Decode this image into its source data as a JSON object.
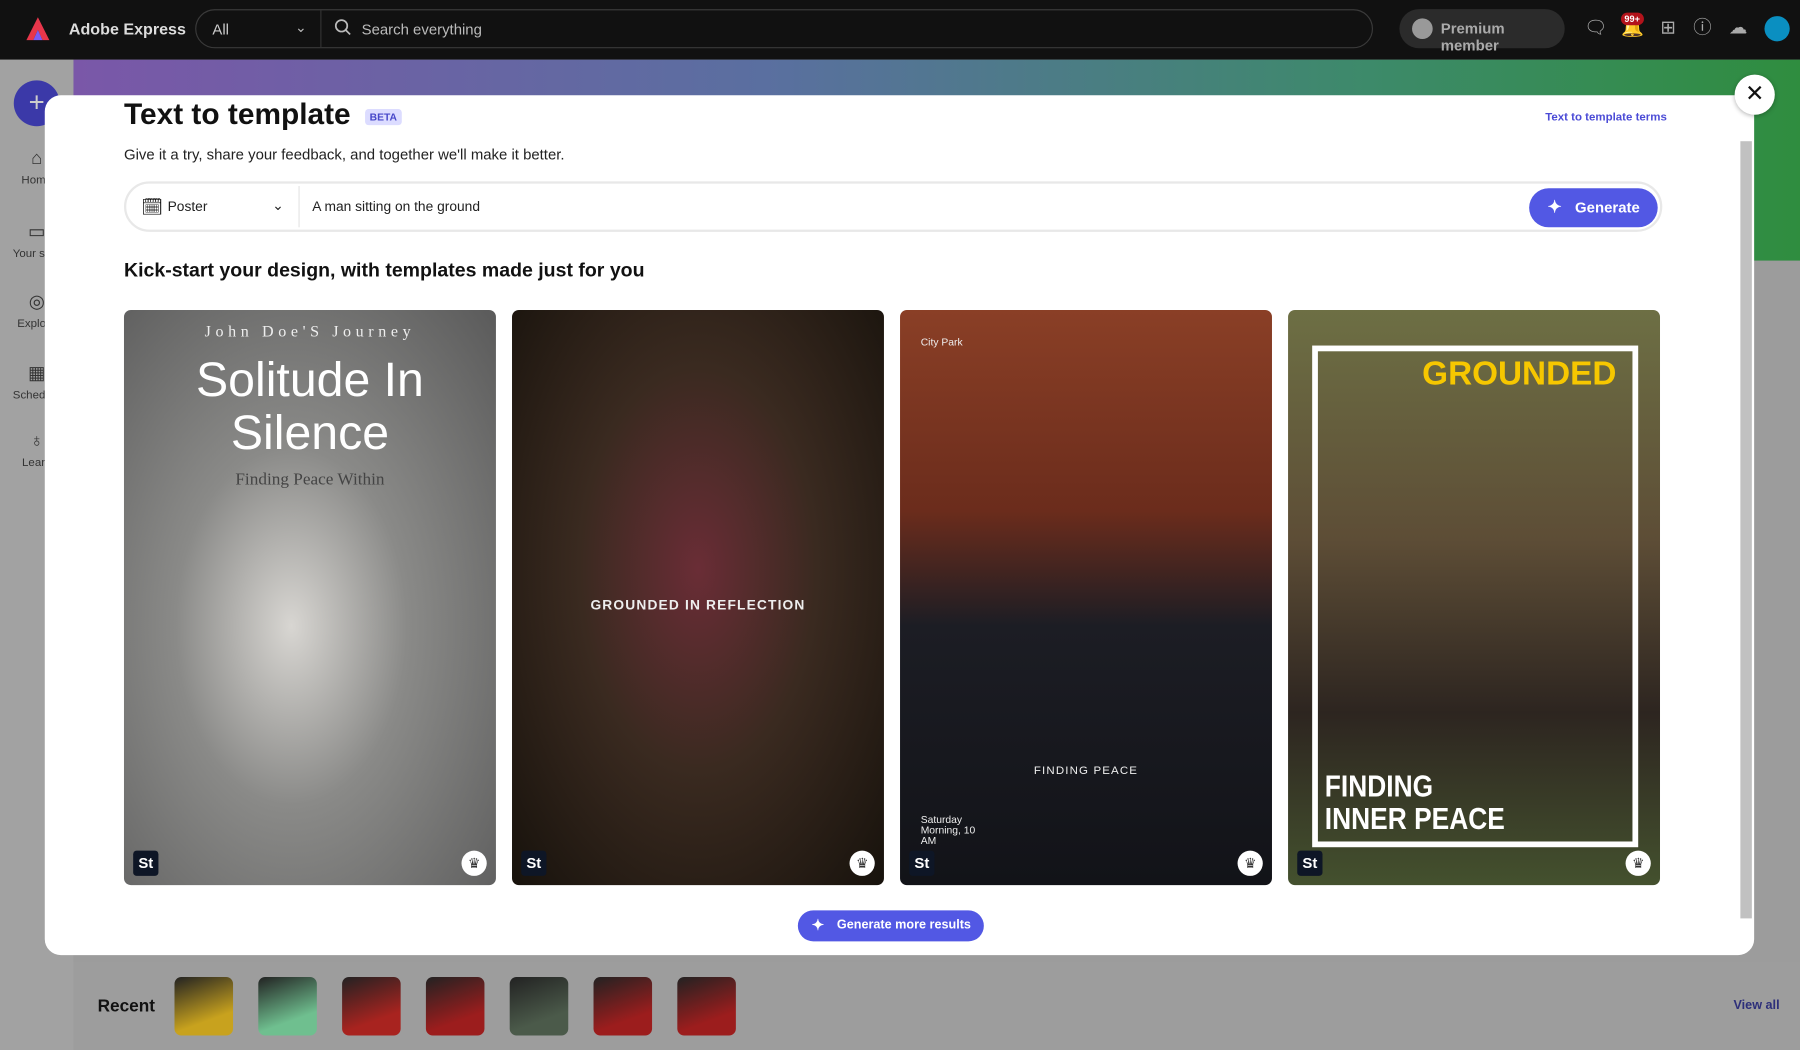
{
  "topbar": {
    "brand": "Adobe Express",
    "scope": "All",
    "search_placeholder": "Search everything",
    "premium": "Premium member",
    "notification_badge": "99+",
    "icons": [
      "chat-icon",
      "bell-icon",
      "apps-grid-icon",
      "help-icon",
      "creative-cloud-icon",
      "avatar"
    ]
  },
  "sidebar": {
    "items": [
      {
        "label": "Home",
        "icon": "home-icon"
      },
      {
        "label": "Your stuff",
        "icon": "folder-icon"
      },
      {
        "label": "Explore",
        "icon": "compass-icon"
      },
      {
        "label": "Schedule",
        "icon": "calendar-icon"
      },
      {
        "label": "Learn",
        "icon": "lightbulb-icon"
      }
    ]
  },
  "modal": {
    "title": "Text to template",
    "beta": "BETA",
    "terms_link": "Text to template terms",
    "subtitle": "Give it a try, share your feedback, and together we'll make it better.",
    "prompt": {
      "type": "Poster",
      "value": "A man sitting on the ground",
      "generate": "Generate"
    },
    "section_title": "Kick-start your design, with templates made just for you",
    "cards": [
      {
        "texts": [
          "John Doe'S Journey",
          "Solitude In Silence",
          "Finding Peace Within"
        ],
        "badge": "St"
      },
      {
        "texts": [
          "GROUNDED IN REFLECTION"
        ],
        "badge": "St"
      },
      {
        "texts": [
          "City Park",
          "FINDING PEACE",
          "Saturday Morning, 10 AM"
        ],
        "badge": "St"
      },
      {
        "texts": [
          "GROUNDED",
          "FINDING INNER PEACE"
        ],
        "badge": "St"
      }
    ],
    "generate_more": "Generate more results",
    "close": "✕"
  },
  "recent": {
    "label": "Recent",
    "view_all": "View all",
    "thumb_colors": [
      "#c8a21e",
      "#6fbf8f",
      "#a8231f",
      "#9c1d1d",
      "#4b5a4a",
      "#9c1d1d",
      "#9c1d1d"
    ]
  },
  "colors": {
    "accent": "#5258e4",
    "link": "#4b4bd6",
    "grounded_yellow": "#f6c700"
  }
}
